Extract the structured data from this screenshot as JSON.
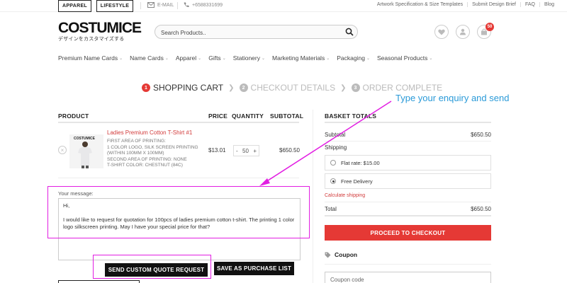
{
  "topbar": {
    "apparel_label": "APPAREL",
    "lifestyle_label": "LIFESTYLE",
    "email_label": "E-MAIL",
    "phone": "+6588331699",
    "links": [
      "Artwork Specification & Size Templates",
      "Submit Design Brief",
      "FAQ",
      "Blog"
    ]
  },
  "header": {
    "logo_main": "COSTUMICE",
    "logo_sub": "デザインをカスタマイズする",
    "search_placeholder": "Search Products..",
    "cart_count": "50"
  },
  "nav": {
    "items": [
      "Premium Name Cards",
      "Name Cards",
      "Apparel",
      "Gifts",
      "Stationery",
      "Marketing Materials",
      "Packaging",
      "Seasonal Products"
    ]
  },
  "steps": [
    {
      "num": "1",
      "label": "SHOPPING CART"
    },
    {
      "num": "2",
      "label": "CHECKOUT DETAILS"
    },
    {
      "num": "3",
      "label": "ORDER COMPLETE"
    }
  ],
  "annotation": {
    "text": "Type your enquiry and send",
    "color": "#e21ee2",
    "text_color": "#2a9ad8"
  },
  "cart": {
    "headers": {
      "product": "PRODUCT",
      "price": "PRICE",
      "quantity": "QUANTITY",
      "subtotal": "SUBTOTAL"
    },
    "item": {
      "name": "Ladies Premium Cotton T-Shirt #1",
      "details": [
        "FIRST AREA OF PRINTING:",
        "1 COLOR LOGO, SILK SCREEN PRINTING",
        "(WITHIN 100MM X 100MM)",
        "SECOND AREA OF PRINTING: NONE",
        "T-SHIRT COLOR: CHESTNUT (84C)"
      ],
      "price": "$13.01",
      "quantity": "50",
      "subtotal": "$650.50"
    }
  },
  "message": {
    "label": "Your message:",
    "greeting": "Hi,",
    "body": "I would like to request for quotation for 100pcs of ladies premium cotton t-shirt. The printing 1 color logo silkscreen printing. May I have your special price for that?"
  },
  "buttons": {
    "send_quote": "SEND CUSTOM QUOTE REQUEST",
    "save_purchase": "SAVE AS PURCHASE LIST"
  },
  "basket": {
    "title": "BASKET TOTALS",
    "subtotal_label": "Subtotal",
    "subtotal_value": "$650.50",
    "shipping_label": "Shipping",
    "flat_rate": "Flat rate: $15.00",
    "free_delivery": "Free Delivery",
    "calculate_shipping": "Calculate shipping",
    "total_label": "Total",
    "total_value": "$650.50",
    "checkout": "PROCEED TO CHECKOUT",
    "coupon_title": "Coupon",
    "coupon_placeholder": "Coupon code"
  },
  "colors": {
    "accent": "#e53935",
    "link_red": "#d23b3b"
  }
}
